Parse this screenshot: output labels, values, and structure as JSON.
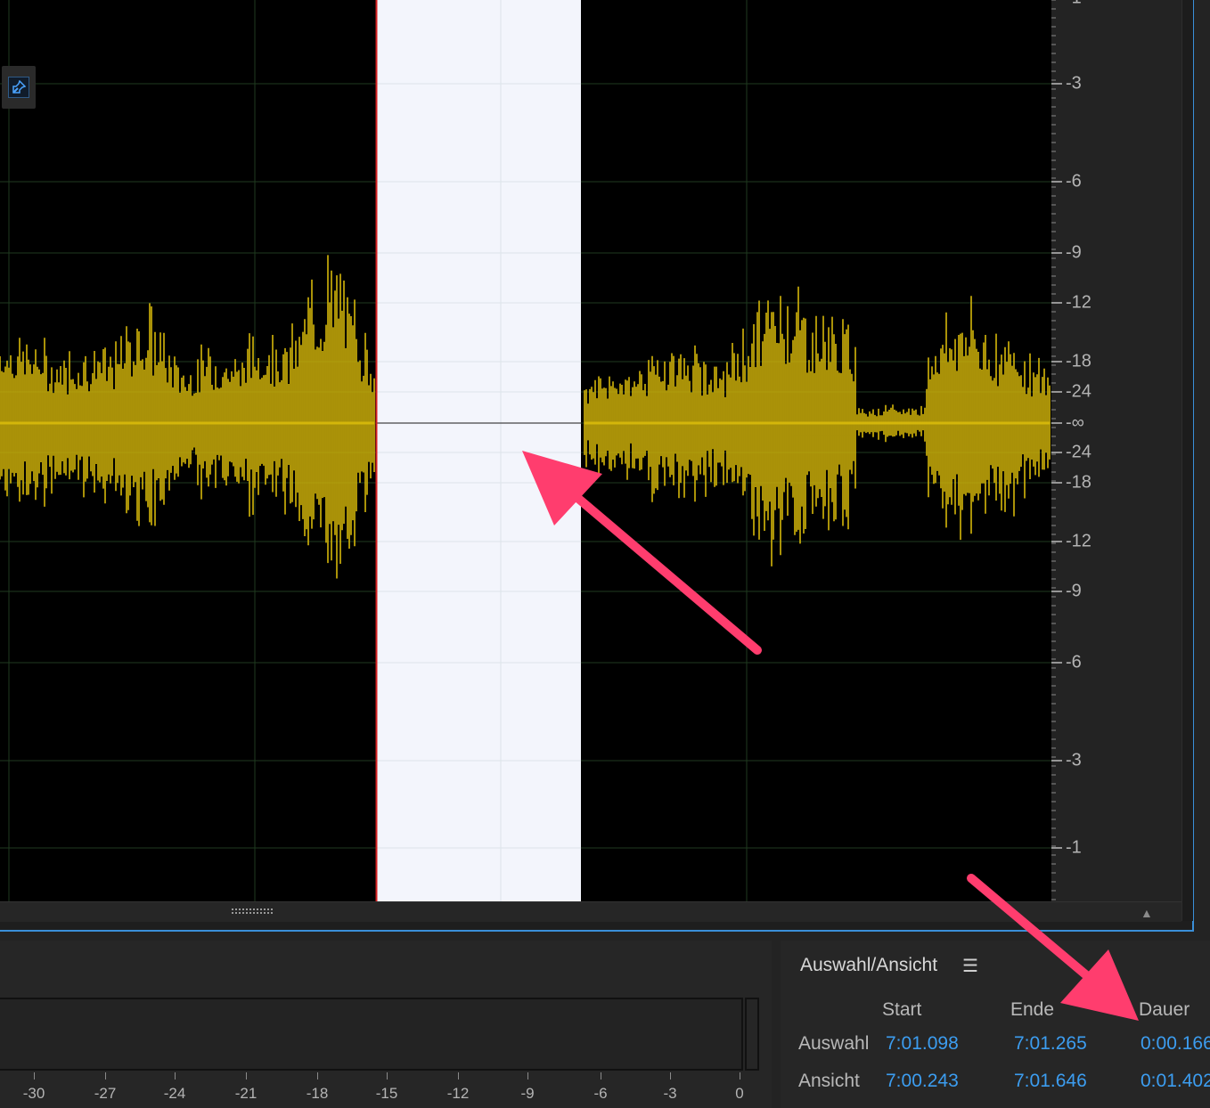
{
  "db_ruler": {
    "labels": [
      "-1",
      "-3",
      "-6",
      "-9",
      "-12",
      "-18",
      "-24",
      "-∞",
      "-24",
      "-18",
      "-12",
      "-9",
      "-6",
      "-3",
      "-1"
    ]
  },
  "level_meter": {
    "labels": [
      "-30",
      "-27",
      "-24",
      "-21",
      "-18",
      "-15",
      "-12",
      "-9",
      "-6",
      "-3",
      "0"
    ]
  },
  "selection_panel": {
    "title": "Auswahl/Ansicht",
    "menu_icon": "hamburger-menu-icon",
    "columns": {
      "start": "Start",
      "end": "Ende",
      "duration": "Dauer"
    },
    "rows": [
      {
        "label": "Auswahl",
        "start": "7:01.098",
        "end": "7:01.265",
        "duration": "0:00.166"
      },
      {
        "label": "Ansicht",
        "start": "7:00.243",
        "end": "7:01.646",
        "duration": "0:01.402"
      }
    ]
  },
  "colors": {
    "waveform": "#d4b60a",
    "selection": "#f3f5fc",
    "accent_blue": "#3c9df0",
    "annotation_arrow": "#ff3d6e",
    "playhead": "#d42020"
  },
  "icons": {
    "pin": "pin-icon",
    "scroll_grip": "grip-icon",
    "scroll_up": "chevron-up-icon"
  }
}
